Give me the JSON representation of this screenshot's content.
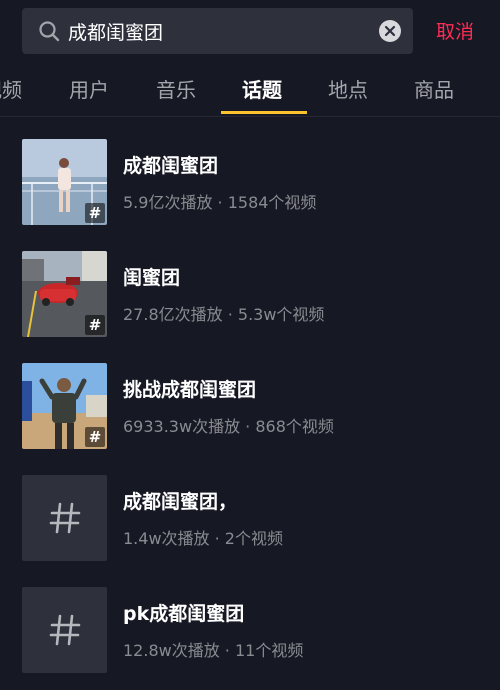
{
  "search": {
    "query": "成都闺蜜团",
    "cancel_label": "取消"
  },
  "tabs": [
    {
      "label": "视频",
      "active": false
    },
    {
      "label": "用户",
      "active": false
    },
    {
      "label": "音乐",
      "active": false
    },
    {
      "label": "话题",
      "active": true
    },
    {
      "label": "地点",
      "active": false
    },
    {
      "label": "商品",
      "active": false
    }
  ],
  "results": [
    {
      "title": "成都闺蜜团",
      "stats": "5.9亿次播放 · 1584个视频",
      "thumb": "photo-woman-on-deck"
    },
    {
      "title": "闺蜜团",
      "stats": "27.8亿次播放 · 5.3w个视频",
      "thumb": "photo-red-car"
    },
    {
      "title": "挑战成都闺蜜团",
      "stats": "6933.3w次播放 · 868个视频",
      "thumb": "photo-man-posing"
    },
    {
      "title": "成都闺蜜团，",
      "stats": "1.4w次播放 · 2个视频",
      "thumb": "hashtag-placeholder"
    },
    {
      "title": "pk成都闺蜜团",
      "stats": "12.8w次播放 · 11个视频",
      "thumb": "hashtag-placeholder"
    }
  ],
  "colors": {
    "background": "#161823",
    "accent": "#fe2c55",
    "indicator": "#fac32d",
    "muted": "#8a8b91"
  }
}
